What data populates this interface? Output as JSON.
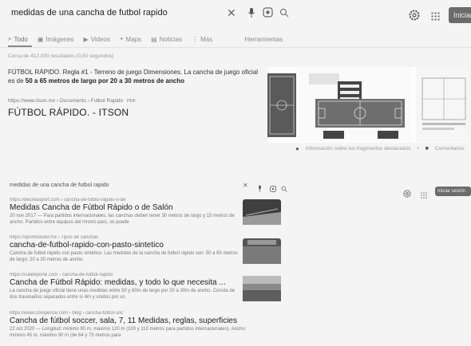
{
  "top": {
    "query": "medidas de una cancha de futbol rapido",
    "signin_label": "Iniciar",
    "tabs": [
      {
        "label": "Todo",
        "icon": "search-icon"
      },
      {
        "label": "Imágenes",
        "icon": "image-icon"
      },
      {
        "label": "Videos",
        "icon": "video-icon"
      },
      {
        "label": "Maps",
        "icon": "map-pin-icon"
      },
      {
        "label": "Noticias",
        "icon": "news-icon"
      },
      {
        "label": "Más",
        "icon": "more-icon"
      }
    ],
    "tools_label": "Herramientas",
    "stats": "Cerca de 412.000 resultados (0,50 segundos)",
    "snippet_part1": "FÚTBOL RÁPIDO. Regla #1 - Terreno de juego Dimensiones. La cancha de juego oficial es de ",
    "snippet_bold": "50 a 65 metros de largo por 20 a 30 metros de ancho",
    "cite": "https://www.itson.mx › Documents › Futbol Rapido",
    "cite_tag": "PDF",
    "title": "FÚTBOL RÁPIDO. - ITSON",
    "featured_footer_info": "Información sobre los fragmentos destacados",
    "featured_footer_feedback": "Comentarios",
    "colors": {
      "button": "#6b6b6b",
      "background": "#f4f4f4"
    }
  },
  "bottom": {
    "query": "medidas de una cancha de futbol rapido",
    "signin_label": "Iniciar sesión",
    "results": [
      {
        "cite": "https://decreasport.com › cancha-de-futbol-rapido-o-de",
        "title": "Medidas Cancha de Fútbol Rápido o de Salón",
        "snippet": "20 nov 2017 — Para partidos internacionales, las canchas deben tener 30 metros de largo y 15 metros de ancho. Partidos entre equipos del mismo país, se puede"
      },
      {
        "cite": "https://sportmaster.mx › Tipos de canchas",
        "title": "cancha-de-futbol-rapido-con-pasto-sintetico",
        "snippet": "Cancha de futbol rápido con pasto sintético. Las medidas de la cancha de futbol rápido son: 50 a 65 metros de largo; 20 a 30 metros de ancho."
      },
      {
        "cite": "https://isaldeporte.com › cancha-de-futbol-rapido",
        "title": "Cancha de Fútbol Rápido: medidas, y todo lo que necesita ...",
        "snippet": "La cancha de juego oficial tiene unas medidas entre 50 y 60m de largo por 20 a 30m de ancho. Consta de dos travesaños separados entre sí 4m y unidos por un"
      },
      {
        "cite": "https://www.compenze.com › blog › cancha-futbol-soc",
        "title": "Cancha de fútbol soccer, sala, 7, 11 Medidas, reglas, superficies",
        "snippet": "22 oct 2020 — Longitud: mínimo 90 m, máximo 120 m (100 y 110 metros para partidos internacionales). Ancho: mínimo 45 m, máximo 90 m (de 64 y 75 metros para"
      }
    ]
  }
}
